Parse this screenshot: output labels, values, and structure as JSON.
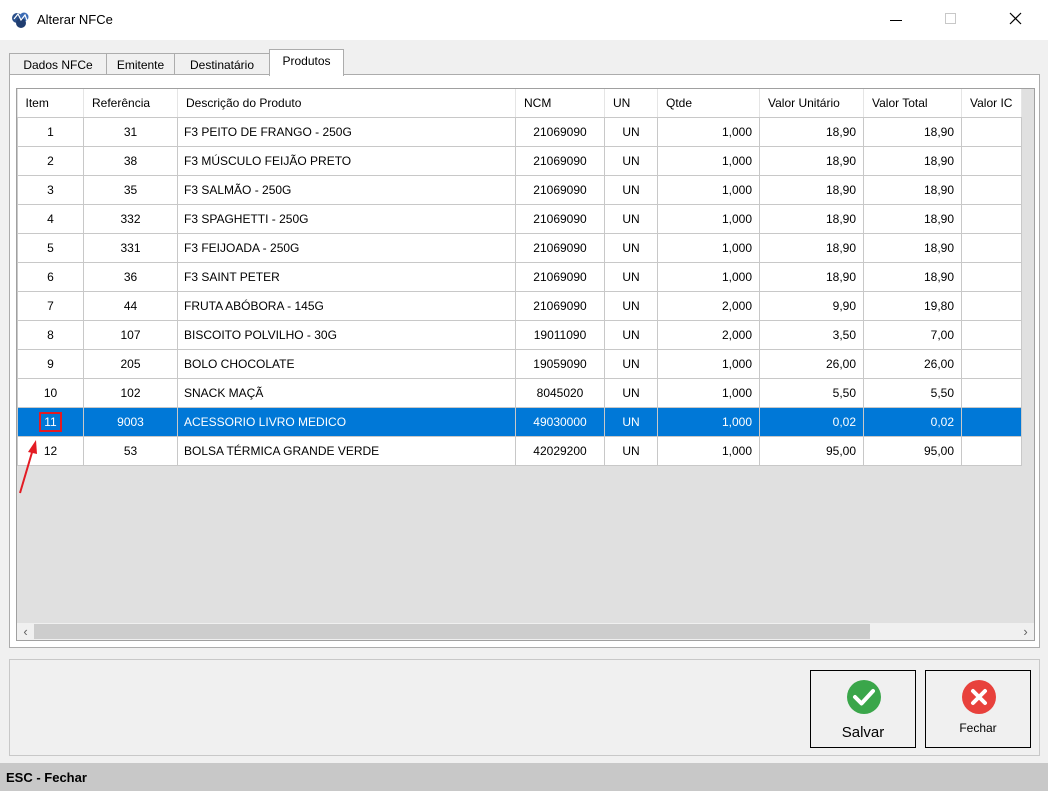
{
  "window": {
    "title": "Alterar NFCe"
  },
  "tabs": [
    "Dados NFCe",
    "Emitente",
    "Destinatário",
    "Produtos"
  ],
  "table": {
    "columns": [
      "Item",
      "Referência",
      "Descrição do Produto",
      "NCM",
      "UN",
      "Qtde",
      "Valor Unitário",
      "Valor Total",
      "Valor IC"
    ],
    "rows": [
      [
        "1",
        "31",
        "F3 PEITO DE FRANGO - 250G",
        "21069090",
        "UN",
        "1,000",
        "18,90",
        "18,90"
      ],
      [
        "2",
        "38",
        "F3 MÚSCULO FEIJÃO PRETO",
        "21069090",
        "UN",
        "1,000",
        "18,90",
        "18,90"
      ],
      [
        "3",
        "35",
        "F3 SALMÃO - 250G",
        "21069090",
        "UN",
        "1,000",
        "18,90",
        "18,90"
      ],
      [
        "4",
        "332",
        "F3 SPAGHETTI - 250G",
        "21069090",
        "UN",
        "1,000",
        "18,90",
        "18,90"
      ],
      [
        "5",
        "331",
        "F3 FEIJOADA - 250G",
        "21069090",
        "UN",
        "1,000",
        "18,90",
        "18,90"
      ],
      [
        "6",
        "36",
        "F3 SAINT PETER",
        "21069090",
        "UN",
        "1,000",
        "18,90",
        "18,90"
      ],
      [
        "7",
        "44",
        "FRUTA ABÓBORA - 145G",
        "21069090",
        "UN",
        "2,000",
        "9,90",
        "19,80"
      ],
      [
        "8",
        "107",
        "BISCOITO POLVILHO - 30G",
        "19011090",
        "UN",
        "2,000",
        "3,50",
        "7,00"
      ],
      [
        "9",
        "205",
        "BOLO CHOCOLATE",
        "19059090",
        "UN",
        "1,000",
        "26,00",
        "26,00"
      ],
      [
        "10",
        "102",
        "SNACK MAÇÃ",
        "8045020",
        "UN",
        "1,000",
        "5,50",
        "5,50"
      ],
      [
        "11",
        "9003",
        "ACESSORIO LIVRO MEDICO",
        "49030000",
        "UN",
        "1,000",
        "0,02",
        "0,02"
      ],
      [
        "12",
        "53",
        "BOLSA TÉRMICA GRANDE VERDE",
        "42029200",
        "UN",
        "1,000",
        "95,00",
        "95,00"
      ]
    ]
  },
  "buttons": {
    "save": "Salvar",
    "close": "Fechar"
  },
  "status": "ESC - Fechar",
  "colors": {
    "selection": "#0078d7",
    "annotation": "#e31b23",
    "save_icon": "#3aa64a",
    "close_icon": "#e8413c"
  }
}
